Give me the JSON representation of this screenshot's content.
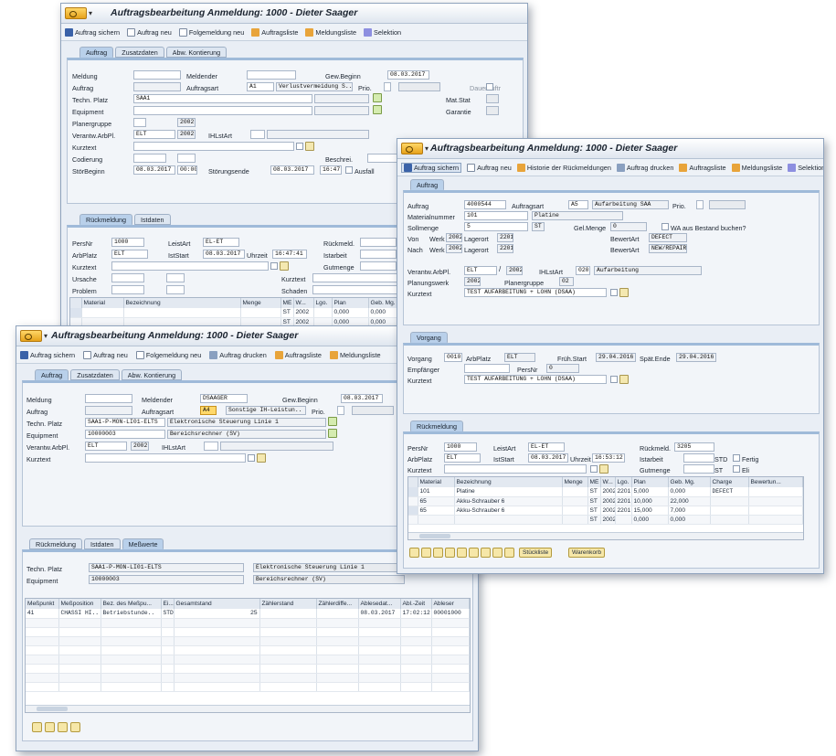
{
  "w1": {
    "title": "Auftragsbearbeitung Anmeldung:  1000 - Dieter Saager",
    "toolbar": [
      "Auftrag sichern",
      "Auftrag neu",
      "Folgemeldung neu",
      "Auftragsliste",
      "Meldungsliste",
      "Selektion"
    ],
    "tabs": [
      "Auftrag",
      "Zusatzdaten",
      "Abw. Kontierung"
    ],
    "labels": {
      "meldung": "Meldung",
      "meldender": "Meldender",
      "gew_beginn": "Gew.Beginn",
      "auftrag": "Auftrag",
      "auftragsart": "Auftragsart",
      "prio": "Prio.",
      "dauerauftr": "Dauerauftr",
      "techn_platz": "Techn. Platz",
      "mat_stat": "Mat.Stat",
      "equipment": "Equipment",
      "garantie": "Garantie",
      "planergruppe": "Planergruppe",
      "verantw": "Verantw.ArbPl.",
      "ihlstart": "IHLstArt",
      "kurztext": "Kurztext",
      "codierung": "Codierung",
      "beschrei": "Beschrei.",
      "stoerbeginn": "StörBeginn",
      "stoerungsende": "Störungsende",
      "ausfall": "Ausfall"
    },
    "values": {
      "gew_beginn": "08.03.2017",
      "auftragsart": "A1",
      "auftragsart_text": "Verlustvermeidung S..",
      "techn_platz": "SAA1",
      "planergruppe": "2002",
      "verantw": "ELT",
      "verantw_werk": "2002",
      "stoer_date": "08.03.2017",
      "stoer_time": "00:00",
      "ende_date": "08.03.2017",
      "ende_time": "16:47"
    },
    "tabs2": [
      "Rückmeldung",
      "Istdaten"
    ],
    "labels2": {
      "persnr": "PersNr",
      "leistart": "LeistArt",
      "rueckmeld": "Rückmeld.",
      "arbplatz": "ArbPlatz",
      "iststart": "IstStart",
      "uhrzeit": "Uhrzeit",
      "istarbeit": "Istarbeit",
      "kurztext": "Kurztext",
      "gutmenge": "Gutmenge",
      "ursache": "Ursache",
      "kurztext2": "Kurztext",
      "problem": "Problem",
      "schaden": "Schaden"
    },
    "values2": {
      "persnr": "1000",
      "leistart": "EL-ET",
      "arbplatz": "ELT",
      "iststart": "08.03.2017",
      "uhrzeit": "16:47:41"
    },
    "table_headers": [
      "Material",
      "Bezeichnung",
      "Menge",
      "ME",
      "W...",
      "Lgo.",
      "Plan",
      "Geb. Mg."
    ],
    "table_rows": [
      {
        "me": "ST",
        "w": "2002",
        "plan": "0,000",
        "geb": "0,000"
      },
      {
        "me": "ST",
        "w": "2002",
        "plan": "0,000",
        "geb": "0,000"
      }
    ]
  },
  "w2": {
    "title": "Auftragsbearbeitung Anmeldung:  1000 - Dieter Saager",
    "toolbar": [
      "Auftrag sichern",
      "Auftrag neu",
      "Historie der Rückmeldungen",
      "Auftrag drucken",
      "Auftragsliste",
      "Meldungsliste",
      "Selektion"
    ],
    "tab1": "Auftrag",
    "labels": {
      "auftrag": "Auftrag",
      "auftragsart": "Auftragsart",
      "prio": "Prio.",
      "materialnummer": "Materialnummer",
      "sollmenge": "Sollmenge",
      "gelmenge": "Gel.Menge",
      "wa_bestand": "WA aus Bestand buchen?",
      "von": "Von",
      "nach": "Nach",
      "werk": "Werk",
      "lagerort": "Lagerort",
      "bewertart": "BewertArt",
      "verantw": "Verantw.ArbPl.",
      "ihlstart": "IHLstArt",
      "planungswerk": "Planungswerk",
      "planergruppe": "Planergruppe",
      "kurztext": "Kurztext"
    },
    "values": {
      "auftrag": "4000544",
      "auftragsart": "A5",
      "auftragsart_text": "Aufarbeitung SAA",
      "materialnummer": "101",
      "material_text": "Platine",
      "sollmenge": "5",
      "sollmenge_me": "ST",
      "gelmenge": "0",
      "von_werk": "2002",
      "von_lagerort": "2201",
      "von_bewertart": "DEFECT",
      "nach_werk": "2002",
      "nach_lagerort": "2201",
      "nach_bewertart": "NEW/REPAIR",
      "verantw": "ELT",
      "verantw_werk": "2002",
      "ihlstart": "020",
      "ihlstart_text": "Aufarbeitung",
      "planungswerk": "2002",
      "planergruppe": "02",
      "kurztext": "TEST AUFARBEITUNG  + LOHN (DSAA)"
    },
    "tab2": "Vorgang",
    "vorgang_labels": {
      "vorgang": "Vorgang",
      "arbplatz": "ArbPlatz",
      "fruehstart": "Früh.Start",
      "spaetende": "Spät.Ende",
      "empfaenger": "Empfänger",
      "persnr": "PersNr",
      "kurztext": "Kurztext"
    },
    "vorgang_values": {
      "vorgang": "0010",
      "arbplatz": "ELT",
      "fruehstart": "29.04.2016",
      "spaetende": "29.04.2016",
      "persnr": "0",
      "kurztext": "TEST AUFARBEITUNG  + LOHN (DSAA)"
    },
    "tab3": "Rückmeldung",
    "rm_labels": {
      "persnr": "PersNr",
      "leistart": "LeistArt",
      "rueckmeld": "Rückmeld.",
      "arbplatz": "ArbPlatz",
      "iststart": "IstStart",
      "uhrzeit": "Uhrzeit",
      "istarbeit": "Istarbeit",
      "fertig": "Fertig",
      "kurztext": "Kurztext",
      "gutmenge": "Gutmenge",
      "eli": "Eli"
    },
    "rm_values": {
      "persnr": "1000",
      "leistart": "EL-ET",
      "rueckmeld": "3205",
      "arbplatz": "ELT",
      "iststart": "08.03.2017",
      "uhrzeit": "16:53:12",
      "istarbeit_me": "STD",
      "gutmenge_me": "ST"
    },
    "table_headers": [
      "Material",
      "Bezeichnung",
      "Menge",
      "ME",
      "W...",
      "Lgo.",
      "Plan",
      "Geb. Mg.",
      "Charge",
      "Bewertun..."
    ],
    "table_rows": [
      {
        "material": "101",
        "bez": "Platine",
        "me": "ST",
        "w": "2002",
        "lgo": "2201",
        "plan": "5,000",
        "geb": "0,000",
        "charge": "DEFECT"
      },
      {
        "material": "65",
        "bez": "Akku-Schrauber 6",
        "me": "ST",
        "w": "2002",
        "lgo": "2201",
        "plan": "10,000",
        "geb": "22,000",
        "charge": ""
      },
      {
        "material": "65",
        "bez": "Akku-Schrauber 6",
        "me": "ST",
        "w": "2002",
        "lgo": "2201",
        "plan": "15,000",
        "geb": "7,000",
        "charge": ""
      },
      {
        "material": "",
        "bez": "",
        "me": "ST",
        "w": "2002",
        "lgo": "",
        "plan": "0,000",
        "geb": "0,000",
        "charge": ""
      }
    ],
    "bottom_buttons": [
      "Stückliste",
      "Warenkorb"
    ]
  },
  "w3": {
    "title": "Auftragsbearbeitung Anmeldung:  1000 - Dieter Saager",
    "toolbar": [
      "Auftrag sichern",
      "Auftrag neu",
      "Folgemeldung neu",
      "Auftrag drucken",
      "Auftragsliste",
      "Meldungsliste"
    ],
    "tabs": [
      "Auftrag",
      "Zusatzdaten",
      "Abw. Kontierung"
    ],
    "labels": {
      "meldung": "Meldung",
      "meldender": "Meldender",
      "gew_beginn": "Gew.Beginn",
      "auftrag": "Auftrag",
      "auftragsart": "Auftragsart",
      "prio": "Prio.",
      "techn_platz": "Techn. Platz",
      "equipment": "Equipment",
      "verantw": "Verantw.ArbPl.",
      "ihlstart": "IHLstArt",
      "kurztext": "Kurztext"
    },
    "values": {
      "meldender": "DSAAGER",
      "gew_beginn": "08.03.2017",
      "auftragsart": "A4",
      "auftragsart_text": "Sonstige IH-Leistun..",
      "techn_platz": "SAA1-P-MON-LI01-ELTS",
      "techn_platz_text": "Elektronische Steuerung Linie 1",
      "equipment": "10000003",
      "equipment_text": "Bereichsrechner (SV)",
      "verantw": "ELT",
      "verantw_werk": "2002"
    },
    "tabs2": [
      "Rückmeldung",
      "Istdaten",
      "Meßwerte"
    ],
    "mw_labels": {
      "techn_platz": "Techn. Platz",
      "equipment": "Equipment"
    },
    "mw_values": {
      "techn_platz": "SAA1-P-MON-LI01-ELTS",
      "techn_platz_text": "Elektronische Steuerung Linie 1",
      "equipment": "10000003",
      "equipment_text": "Bereichsrechner (SV)"
    },
    "table_headers": [
      "Meßpunkt",
      "Meßposition",
      "Bez. des Meßpu...",
      "Ei...",
      "Gesamtstand",
      "Zählerstand",
      "Zählerdiffe...",
      "Ablesedat...",
      "Abl.-Zeit",
      "Ableser"
    ],
    "table_rows": [
      {
        "c0": "41",
        "c1": "CHASSI HI..",
        "c2": "Betriebstunde..",
        "c3": "STD",
        "c4": "25",
        "c5": "",
        "c6": "",
        "c7": "08.03.2017",
        "c8": "17:02:12",
        "c9": "00001000"
      }
    ]
  }
}
